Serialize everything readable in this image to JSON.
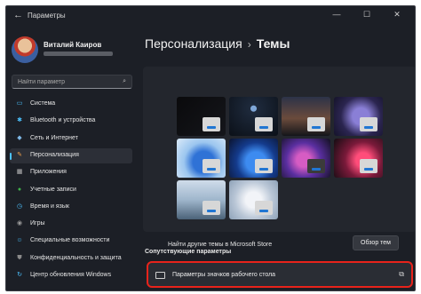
{
  "window": {
    "title": "Параметры",
    "back_icon": "←",
    "controls": {
      "minimize": "—",
      "maximize": "☐",
      "close": "✕"
    }
  },
  "user": {
    "name": "Виталий Каиров"
  },
  "search": {
    "placeholder": "Найти параметр",
    "icon": "⌕"
  },
  "nav": {
    "items": [
      {
        "label": "Система",
        "icon": "system-icon",
        "glyph": "▭",
        "color": "#4cc2ff"
      },
      {
        "label": "Bluetooth и устройства",
        "icon": "bluetooth-icon",
        "glyph": "✱",
        "color": "#4cc2ff"
      },
      {
        "label": "Сеть и Интернет",
        "icon": "network-icon",
        "glyph": "◆",
        "color": "#7fb8e6"
      },
      {
        "label": "Персонализация",
        "icon": "personalization-icon",
        "glyph": "✎",
        "color": "#f0a04b",
        "active": true
      },
      {
        "label": "Приложения",
        "icon": "apps-icon",
        "glyph": "▦",
        "color": "#bdbdbd"
      },
      {
        "label": "Учетные записи",
        "icon": "accounts-icon",
        "glyph": "●",
        "color": "#3fb24a"
      },
      {
        "label": "Время и язык",
        "icon": "time-language-icon",
        "glyph": "◷",
        "color": "#4cc2ff"
      },
      {
        "label": "Игры",
        "icon": "gaming-icon",
        "glyph": "◉",
        "color": "#9a9a9a"
      },
      {
        "label": "Специальные возможности",
        "icon": "accessibility-icon",
        "glyph": "☺",
        "color": "#4cc2ff"
      },
      {
        "label": "Конфиденциальность и защита",
        "icon": "privacy-shield-icon",
        "glyph": "⛊",
        "color": "#8a8a8a"
      },
      {
        "label": "Центр обновления Windows",
        "icon": "windows-update-icon",
        "glyph": "↻",
        "color": "#4cc2ff"
      }
    ]
  },
  "breadcrumb": {
    "parent": "Персонализация",
    "separator": "›",
    "current": "Темы"
  },
  "themes": [
    {
      "name": "theme-dark-black",
      "bg": "linear-gradient(135deg,#0a0a0c,#15161b)",
      "win": "light"
    },
    {
      "name": "theme-earth",
      "bg": "radial-gradient(circle at 50% 30%,#7fa7d8 0 8%,#1e2a3c 9%,#0b1018 100%)",
      "win": "light"
    },
    {
      "name": "theme-night-landscape",
      "bg": "linear-gradient(180deg,#2c3248 0%,#6b4b3c 55%,#14151a 100%)",
      "win": "light"
    },
    {
      "name": "theme-glow-purple",
      "bg": "radial-gradient(circle at 55% 50%,#8a7fd6 0 25%,#2b2550 60%,#15132a 100%)",
      "win": "light"
    },
    {
      "name": "theme-bloom-light",
      "bg": "radial-gradient(circle at 55% 60%,#2f72d6 0 30%,#9cc6ef 55%,#dbeaf8 100%)",
      "win": "light"
    },
    {
      "name": "theme-bloom-dark",
      "bg": "radial-gradient(circle at 55% 60%,#3d8bf0 0 28%,#143b8c 55%,#0b1430 100%)",
      "win": "light"
    },
    {
      "name": "theme-captured-motion",
      "bg": "radial-gradient(circle at 45% 55%,#d65cc3 0 20%,#5a2fa0 50%,#12101f 100%)",
      "win": "dark"
    },
    {
      "name": "theme-flow",
      "bg": "radial-gradient(circle at 60% 55%,#ff4d7a 0 20%,#7a1a3a 50%,#140c12 100%)",
      "win": "light"
    },
    {
      "name": "theme-sunrise-lake",
      "bg": "linear-gradient(180deg,#cfdcea 0%,#9fb6cc 50%,#4b6278 100%)",
      "win": "light"
    },
    {
      "name": "theme-glow-light",
      "bg": "radial-gradient(circle at 50% 50%,#f2f4f8 0 25%,#b9c6d6 60%,#8ea2b8 100%)",
      "win": "light"
    }
  ],
  "store": {
    "label": "Найти другие темы в Microsoft Store",
    "button": "Обзор тем"
  },
  "related": {
    "heading": "Сопутствующие параметры",
    "item_label": "Параметры значков рабочего стола",
    "highlight_color": "#e8231b"
  }
}
